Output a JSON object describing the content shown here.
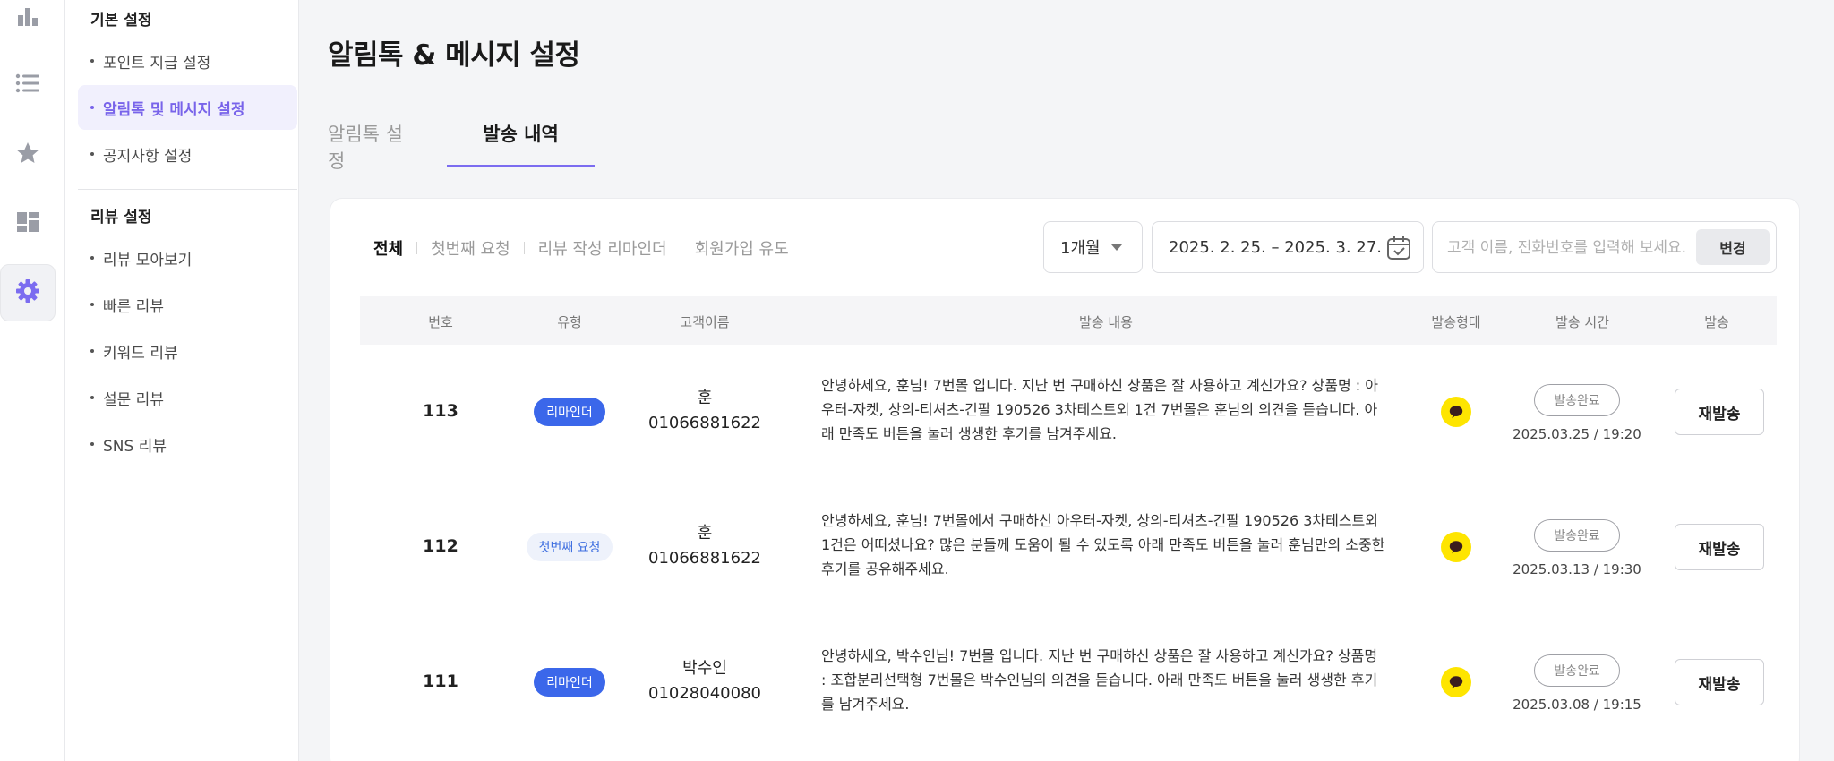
{
  "icon_rail": [
    {
      "icon": "bar-chart-icon",
      "active": false
    },
    {
      "icon": "list-icon",
      "active": false
    },
    {
      "icon": "star-icon",
      "active": false
    },
    {
      "icon": "dashboard-icon",
      "active": false
    },
    {
      "icon": "gear-icon",
      "active": true
    }
  ],
  "sidebar": {
    "basic_title": "기본 설정",
    "basic_items": [
      "포인트 지급 설정",
      "알림톡 및 메시지 설정",
      "공지사항 설정"
    ],
    "review_title": "리뷰 설정",
    "review_items": [
      "리뷰 모아보기",
      "빠른 리뷰",
      "키워드 리뷰",
      "설문 리뷰",
      "SNS 리뷰"
    ]
  },
  "page": {
    "title": "알림톡 & 메시지 설정",
    "tabs": [
      "알림톡 설정",
      "발송 내역"
    ]
  },
  "filters": {
    "types": [
      "전체",
      "첫번째 요청",
      "리뷰 작성 리마인더",
      "회원가입 유도"
    ],
    "period": "1개월",
    "date_range": "2025. 2. 25.  – 2025. 3. 27.",
    "search_placeholder": "고객 이름, 전화번호를 입력해 보세요.",
    "change_label": "변경"
  },
  "table": {
    "headers": [
      "번호",
      "유형",
      "고객이름",
      "발송 내용",
      "발송형태",
      "발송 시간",
      "발송"
    ],
    "rows": [
      {
        "no": "113",
        "type": "리마인더",
        "customer_name": "훈",
        "phone": "01066881622",
        "message": "안녕하세요, 훈님! 7번몰 입니다. 지난 번 구매하신 상품은 잘 사용하고 계신가요? 상품명 : 아우터-자켓, 상의-티셔츠-긴팔 190526 3차테스트외 1건 7번몰은 훈님의 의견을 듣습니다. 아래 만족도 버튼을 눌러 생생한 후기를 남겨주세요.",
        "status": "발송완료",
        "time": "2025.03.25 / 19:20",
        "resend": "재발송"
      },
      {
        "no": "112",
        "type": "첫번째 요청",
        "customer_name": "훈",
        "phone": "01066881622",
        "message": "안녕하세요, 훈님! 7번몰에서 구매하신 아우터-자켓, 상의-티셔츠-긴팔 190526 3차테스트외 1건은 어떠셨나요? 많은 분들께 도움이 될 수 있도록 아래 만족도 버튼을 눌러 훈님만의 소중한 후기를 공유해주세요.",
        "status": "발송완료",
        "time": "2025.03.13 / 19:30",
        "resend": "재발송"
      },
      {
        "no": "111",
        "type": "리마인더",
        "customer_name": "박수인",
        "phone": "01028040080",
        "message": "안녕하세요, 박수인님! 7번몰 입니다. 지난 번 구매하신 상품은 잘 사용하고 계신가요? 상품명 : 조합분리선택형 7번몰은 박수인님의 의견을 듣습니다. 아래 만족도 버튼을 눌러 생생한 후기를 남겨주세요.",
        "status": "발송완료",
        "time": "2025.03.08 / 19:15",
        "resend": "재발송"
      }
    ]
  },
  "colors": {
    "accent": "#7863ea",
    "remind_badge": "#3b67ea",
    "kakao_yellow": "#fee500"
  }
}
